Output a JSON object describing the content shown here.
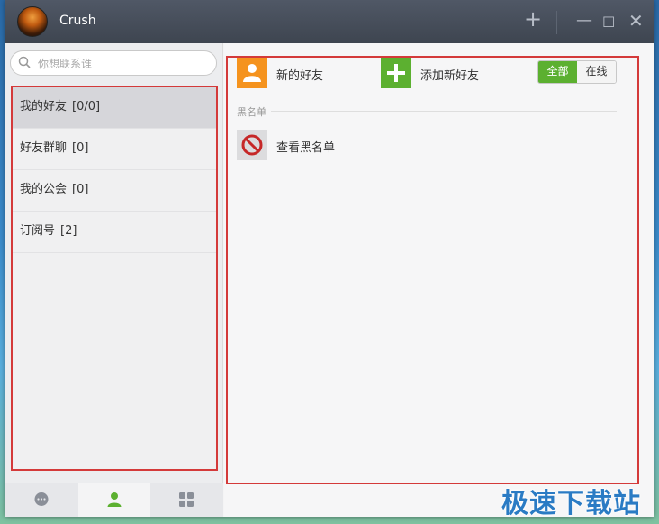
{
  "window": {
    "title": "Crush"
  },
  "titlebar": {
    "add_glyph": "+",
    "min_glyph": "—",
    "max_glyph": "☐",
    "close_glyph": "✕"
  },
  "search": {
    "placeholder": "你想联系谁"
  },
  "groups": [
    {
      "label": "我的好友",
      "count": "[0/0]"
    },
    {
      "label": "好友群聊",
      "count": "[0]"
    },
    {
      "label": "我的公会",
      "count": "[0]"
    },
    {
      "label": "订阅号",
      "count": "[2]"
    }
  ],
  "bottom_nav": {
    "icons": [
      "chat-bubble-icon",
      "contacts-person-icon",
      "apps-grid-icon"
    ],
    "active": "contacts"
  },
  "content": {
    "new_friends_label": "新的好友",
    "add_friend_label": "添加新好友",
    "filter_all": "全部",
    "filter_online": "在线",
    "blacklist_section": "黑名单",
    "view_blacklist_label": "查看黑名单"
  },
  "colors": {
    "orange_accent": "#f5931e",
    "green_accent": "#5cb030",
    "highlight_red": "#d43a3a",
    "titlebar": "#474e5a"
  },
  "watermark": "极速下载站"
}
